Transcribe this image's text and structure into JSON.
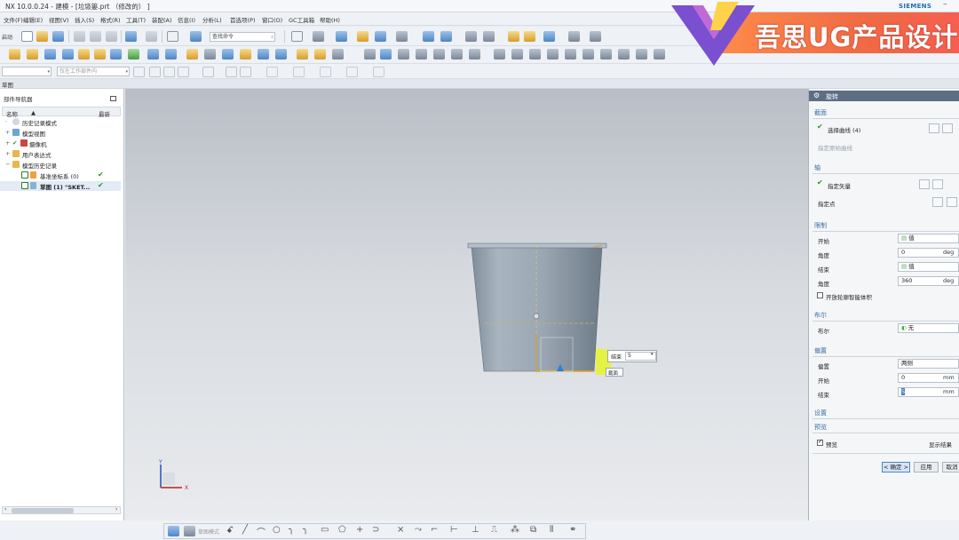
{
  "window": {
    "title": "NX 10.0.0.24 - 建模 - [垃圾篓.prt （修改的） ]",
    "brand": "SIEMENS",
    "minimize_glyph": "–"
  },
  "menu": [
    "文件(F)",
    "编辑(E)",
    "视图(V)",
    "插入(S)",
    "格式(R)",
    "工具(T)",
    "装配(A)",
    "信息(I)",
    "分析(L)",
    "首选项(P)",
    "窗口(O)",
    "GC工具箱",
    "帮助(H)"
  ],
  "toolbar": {
    "start_label": "启动",
    "search_command_placeholder": "查找命令",
    "selection_filter": "仅在工作部件内",
    "sketch_label": "草图"
  },
  "banner": {
    "text": "吾思UG产品设计"
  },
  "part_navigator": {
    "title": "部件导航器",
    "col_name": "名称",
    "col_latest": "最新",
    "items": [
      {
        "label": "历史记录模式",
        "indent": 0,
        "icon": "history-icon",
        "check": ""
      },
      {
        "label": "模型视图",
        "indent": 0,
        "icon": "model-views-icon",
        "check": ""
      },
      {
        "label": "摄像机",
        "indent": 0,
        "icon": "camera-icon",
        "check": "✔"
      },
      {
        "label": "用户表达式",
        "indent": 0,
        "icon": "folder-icon",
        "check": ""
      },
      {
        "label": "模型历史记录",
        "indent": 0,
        "icon": "folder-icon",
        "check": ""
      },
      {
        "label": "基准坐标系 (0)",
        "indent": 1,
        "icon": "datum-csys-icon",
        "check": "✔"
      },
      {
        "label": "草图 (1) \"SKET...",
        "indent": 1,
        "icon": "sketch-icon",
        "check": "✔"
      }
    ]
  },
  "viewport": {
    "popup_label": "结束",
    "popup_value": "5",
    "popup_tip": "截面",
    "axis_labels": {
      "y": "Y",
      "x": "X"
    }
  },
  "dialog": {
    "title": "旋转",
    "sections": {
      "section": "截面",
      "axis": "轴",
      "limits": "限制",
      "boolean": "布尔",
      "offset": "偏置",
      "settings": "设置",
      "preview": "预览"
    },
    "select_curve": "选择曲线 (4)",
    "specify_origin_curve": "指定原始曲线",
    "specify_vector": "指定矢量",
    "specify_point": "指定点",
    "start_label": "开始",
    "start_type": "值",
    "start_angle_label": "角度",
    "start_angle": "0",
    "end_label": "结束",
    "end_type": "值",
    "end_angle_label": "角度",
    "end_angle": "360",
    "angle_unit": "deg",
    "open_profile": "开放轮廓智能体积",
    "boolean_label": "布尔",
    "boolean_value": "无",
    "offset_label": "偏置",
    "offset_value": "两侧",
    "offset_start_label": "开始",
    "offset_start": "0",
    "offset_end_label": "结束",
    "offset_end": "5",
    "length_unit": "mm",
    "preview_label": "预览",
    "show_result": "显示结果",
    "ok_button": "< 确定 >",
    "apply_button": "应用",
    "cancel_button": "取消"
  },
  "bottom_toolbar": {
    "sketch_mode": "草图模式"
  }
}
